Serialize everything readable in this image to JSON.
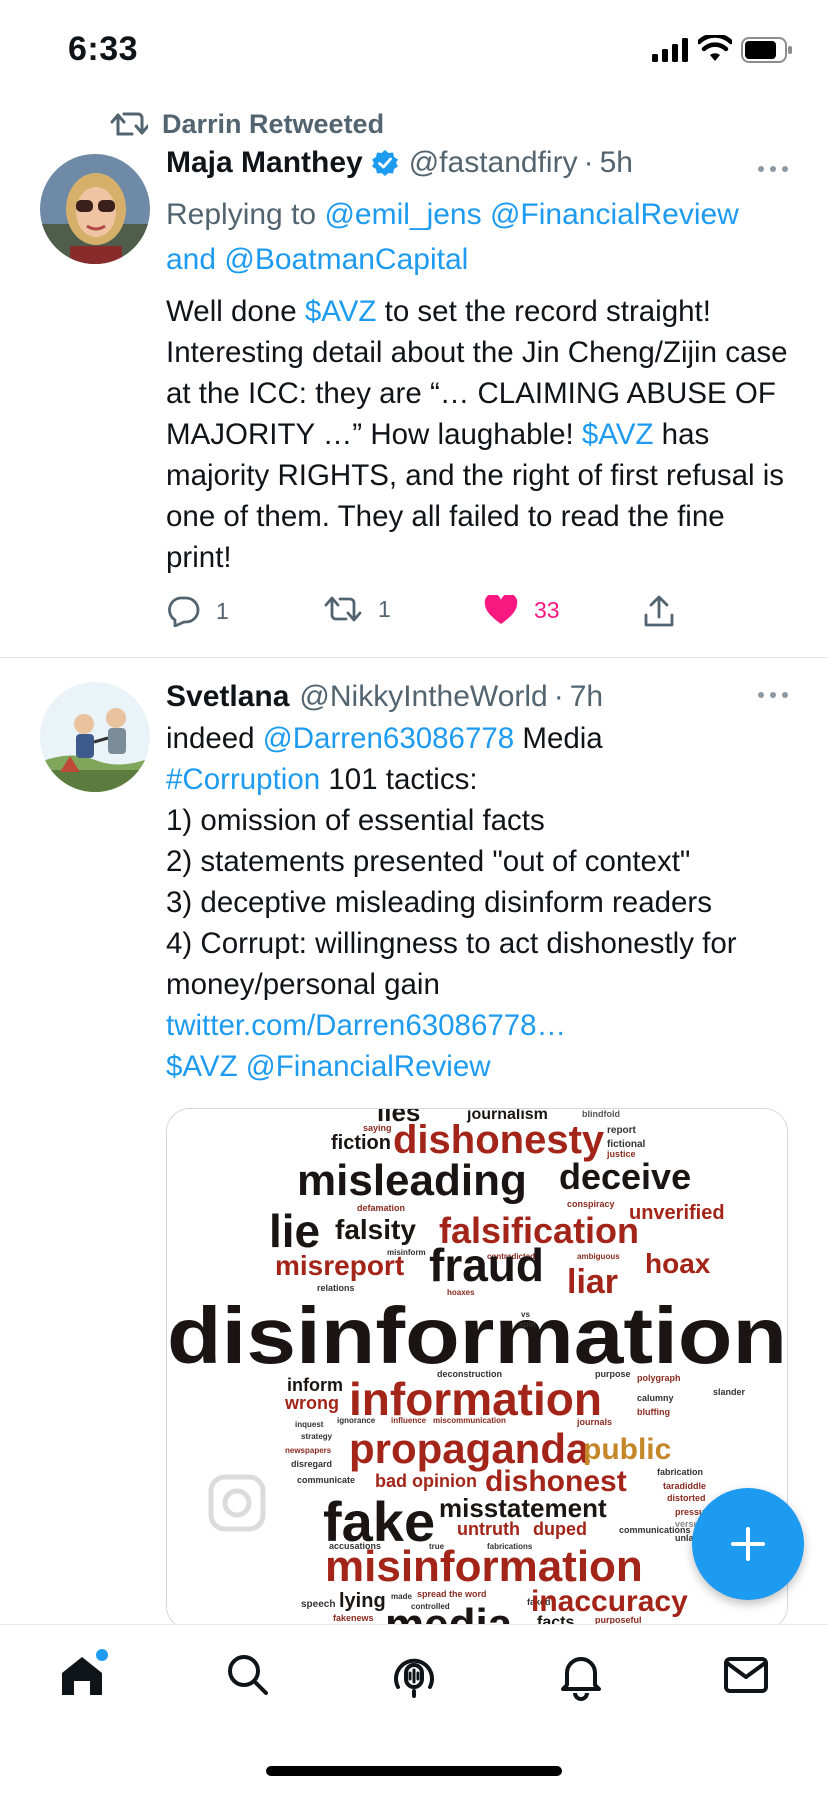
{
  "status_bar": {
    "time": "6:33"
  },
  "retweet_banner": {
    "text": "Darrin Retweeted"
  },
  "tweets": [
    {
      "name": "Maja Manthey",
      "handle": "@fastandfiry",
      "dot": "·",
      "time": "5h",
      "verified": true,
      "reply": {
        "prefix": "Replying to",
        "mention1": "@emil_jens",
        "mention2": "@FinancialReview",
        "and": "and",
        "mention3": "@BoatmanCapital"
      },
      "text": {
        "p1": "Well done ",
        "cashtag1": "$AVZ",
        "p2": " to set the record straight! Interesting detail about the Jin Cheng/Zijin case at the ICC: they are “… CLAIMING ABUSE OF MAJORITY …” How laughable!",
        "cashtag2": "$AVZ",
        "p3": " has majority RIGHTS, and the right of first refusal is one of them. They all failed to read the fine print!"
      },
      "counts": {
        "replies": "1",
        "retweets": "1",
        "likes": "33"
      }
    },
    {
      "name": "Svetlana",
      "handle": "@NikkyIntheWorld",
      "dot": "·",
      "time": "7h",
      "text": {
        "p1": "indeed ",
        "mention1": "@Darren63086778",
        "p2": " Media",
        "hashtag": "#Corruption",
        "p3": " 101 tactics:",
        "l1": "1) omission of essential facts",
        "l2": "2) statements presented \"out of context\"",
        "l3": "3) deceptive misleading disinform readers",
        "l4": "4) Corrupt: willingness to act dishonestly for money/personal gain",
        "url": "twitter.com/Darren63086778…",
        "cashtag": "$AVZ",
        "mention2": "@FinancialReview"
      },
      "image_words": {
        "w01": "lies",
        "w02": "journalism",
        "w03": "saying",
        "w04": "report",
        "w05": "fiction",
        "w06": "dishonesty",
        "w07": "fictional",
        "w08": "justice",
        "w09": "misleading",
        "w10": "deceive",
        "w11": "defamation",
        "w12": "conspiracy",
        "w13": "unverified",
        "w14": "lie",
        "w15": "falsity",
        "w16": "falsification",
        "w17": "misinform",
        "w18": "contradicted",
        "w19": "ambiguous",
        "w20": "misreport",
        "w21": "fraud",
        "w22": "hoax",
        "w23": "liar",
        "w24": "relations",
        "w25": "hoaxes",
        "w26": "disinformation",
        "w27": "inform",
        "w28": "wrong",
        "w29": "information",
        "w30": "deconstruction",
        "w31": "purpose",
        "w32": "polygraph",
        "w33": "slander",
        "w34": "calumny",
        "w35": "bluffing",
        "w36": "inquest",
        "w37": "ignorance",
        "w38": "influence",
        "w39": "miscommunication",
        "w40": "journals",
        "w41": "strategy",
        "w42": "newspapers",
        "w43": "propaganda",
        "w44": "public",
        "w45": "disregard",
        "w46": "fabrication",
        "w47": "communicate",
        "w48": "bad opinion",
        "w49": "dishonest",
        "w50": "taradiddle",
        "w51": "distorted",
        "w52": "misstatement",
        "w53": "pressure",
        "w54": "fake",
        "w55": "untruth",
        "w56": "duped",
        "w57": "unlawful",
        "w58": "accusations",
        "w59": "true",
        "w60": "fabrications",
        "w61": "misinformation",
        "w62": "speech",
        "w63": "lying",
        "w64": "made",
        "w65": "spread the word",
        "w66": "faked",
        "w67": "inaccuracy",
        "w68": "controlled",
        "w69": "fakenews",
        "w70": "media",
        "w71": "facts",
        "w72": "purposeful",
        "w73": "blindfold",
        "w74": "vs",
        "w75": "spin",
        "w76": "communications",
        "w77": "versus"
      }
    }
  ],
  "colors": {
    "accent": "#1d9bf0",
    "like": "#f91880",
    "text": "#0f1419",
    "muted": "#536471"
  },
  "icons": {
    "retweet": "retweet-icon",
    "verified": "verified-badge-icon",
    "more": "more-icon",
    "reply": "reply-icon",
    "like": "heart-filled-icon",
    "share": "share-icon",
    "compose": "plus-icon",
    "home": "home-icon",
    "search": "search-icon",
    "spaces": "spaces-icon",
    "notifications": "bell-icon",
    "messages": "mail-icon"
  }
}
